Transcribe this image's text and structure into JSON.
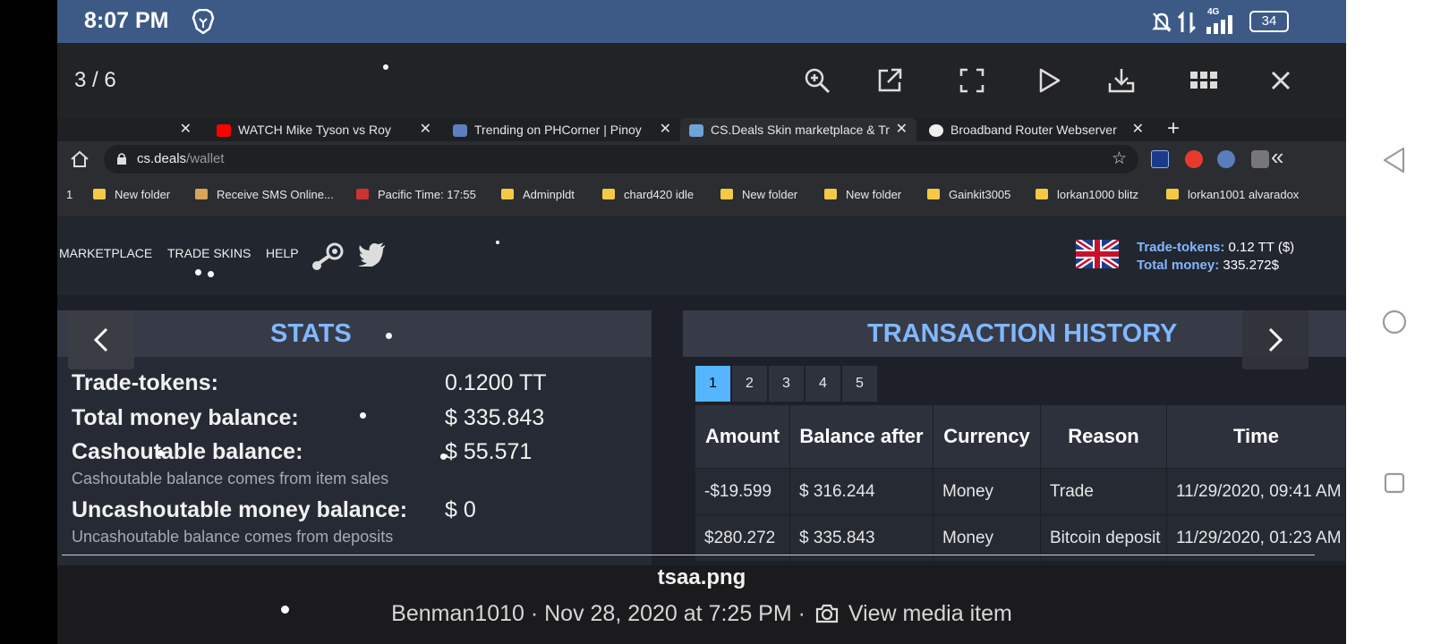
{
  "status_bar": {
    "time": "8:07 PM",
    "network": "4G",
    "battery": "34"
  },
  "viewer": {
    "counter": "3 / 6",
    "filename": "tsaa.png",
    "meta": "Benman1010 · Nov 28, 2020 at 7:25 PM ·",
    "view_media": "View media item"
  },
  "browser": {
    "tabs": [
      {
        "label": "WATCH Mike Tyson vs Roy"
      },
      {
        "label": "Trending on PHCorner | Pinoy"
      },
      {
        "label": "CS.Deals Skin marketplace & Tr"
      },
      {
        "label": "Broadband Router Webserver"
      }
    ],
    "url_domain": "cs.deals",
    "url_path": "/wallet",
    "bookmarks": [
      "1",
      "New folder",
      "Receive SMS Online...",
      "Pacific Time: 17:55",
      "Adminpldt",
      "chard420 idle",
      "New folder",
      "New folder",
      "Gainkit3005",
      "lorkan1000 blitz",
      "lorkan1001 alvaradox"
    ]
  },
  "site": {
    "nav": [
      "MARKETPLACE",
      "TRADE SKINS",
      "HELP"
    ],
    "trade_tokens_label": "Trade-tokens:",
    "trade_tokens_value": "0.12 TT ($)",
    "total_money_label": "Total money:",
    "total_money_value": "335.272$",
    "stats": {
      "title": "STATS",
      "rows": [
        {
          "label": "Trade-tokens:",
          "value": "0.1200 TT"
        },
        {
          "label": "Total money balance:",
          "value": "$ 335.843"
        },
        {
          "label": "Cashoutable balance:",
          "value": "$ 55.571",
          "note": "Cashoutable balance comes from item sales"
        },
        {
          "label": "Uncashoutable money balance:",
          "value": "$ 0",
          "note": "Uncashoutable balance comes from deposits"
        }
      ]
    },
    "history": {
      "title": "TRANSACTION HISTORY",
      "pages": [
        "1",
        "2",
        "3",
        "4",
        "5"
      ],
      "active_page": "1",
      "columns": [
        "Amount",
        "Balance after",
        "Currency",
        "Reason",
        "Time"
      ],
      "rows": [
        [
          "-$19.599",
          "$ 316.244",
          "Money",
          "Trade",
          "11/29/2020, 09:41 AM"
        ],
        [
          "$280.272",
          "$ 335.843",
          "Money",
          "Bitcoin deposit",
          "11/29/2020, 01:23 AM"
        ]
      ]
    }
  },
  "colors": {
    "status_bar": "#3d5a87",
    "accent_blue": "#82b7ff",
    "active_page": "#55b6ff"
  }
}
